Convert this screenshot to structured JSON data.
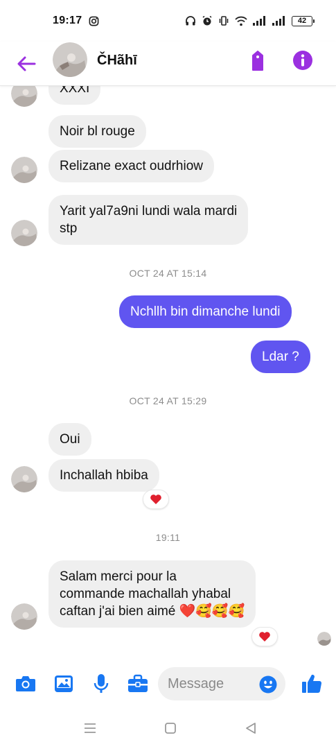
{
  "status_bar": {
    "time": "19:17",
    "battery": "42"
  },
  "header": {
    "contact_name": "ČHãhī"
  },
  "messages": {
    "partial_top": "XXXI",
    "m1": "Noir bl rouge",
    "m2": "Relizane exact oudrhiow",
    "m3_line1": "Yarit yal7a9ni lundi wala mardi",
    "m3_line2": "stp",
    "ts1": "OCT 24 AT 15:14",
    "o1": "Nchllh bin dimanche lundi",
    "o2": "Ldar ?",
    "ts2": "OCT 24 AT 15:29",
    "m4": "Oui",
    "m5": "Inchallah hbiba",
    "ts3": "19:11",
    "m6_line1": "Salam merci pour la",
    "m6_line2": "commande machallah yhabal",
    "m6_line3": "caftan j'ai bien aimé ❤️🥰🥰🥰",
    "reaction": "❤️"
  },
  "composer": {
    "placeholder": "Message"
  },
  "colors": {
    "accent": "#6055f0",
    "header_purple": "#9b30e0",
    "composer_blue": "#1877f2",
    "heart": "#e0202e"
  },
  "icons": {
    "header": [
      "back-arrow-icon",
      "tag-icon",
      "info-icon"
    ],
    "composer": [
      "camera-icon",
      "gallery-icon",
      "microphone-icon",
      "toolbox-icon",
      "emoji-icon",
      "thumbs-up-icon"
    ],
    "navbar": [
      "menu-icon",
      "home-icon",
      "back-icon"
    ]
  }
}
